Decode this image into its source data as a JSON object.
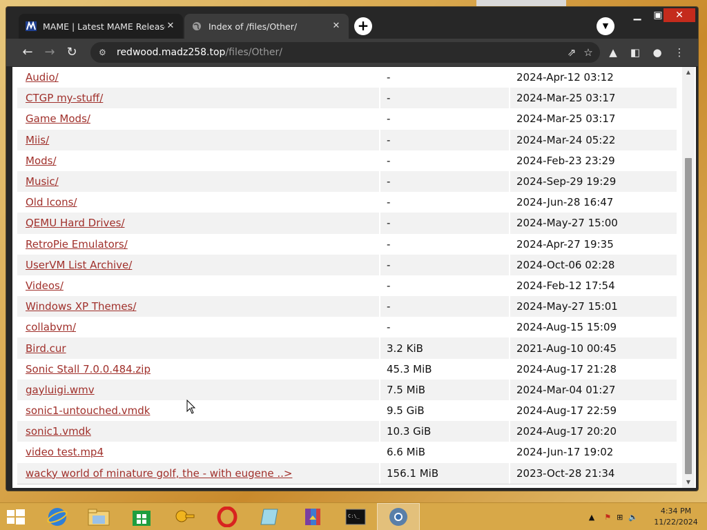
{
  "tabs": [
    {
      "title": "MAME | Latest MAME Release",
      "active": false,
      "favicon": "mame-logo-icon"
    },
    {
      "title": "Index of /files/Other/",
      "active": true,
      "favicon": "globe-icon"
    }
  ],
  "address": {
    "host": "redwood.madz258.top",
    "path": "/files/Other/"
  },
  "listing": [
    {
      "name": "Audio/",
      "size": "-",
      "date": "2024-Apr-12 03:12"
    },
    {
      "name": "CTGP my-stuff/",
      "size": "-",
      "date": "2024-Mar-25 03:17"
    },
    {
      "name": "Game Mods/",
      "size": "-",
      "date": "2024-Mar-25 03:17"
    },
    {
      "name": "Miis/",
      "size": "-",
      "date": "2024-Mar-24 05:22"
    },
    {
      "name": "Mods/",
      "size": "-",
      "date": "2024-Feb-23 23:29"
    },
    {
      "name": "Music/",
      "size": "-",
      "date": "2024-Sep-29 19:29"
    },
    {
      "name": "Old Icons/",
      "size": "-",
      "date": "2024-Jun-28 16:47"
    },
    {
      "name": "QEMU Hard Drives/",
      "size": "-",
      "date": "2024-May-27 15:00"
    },
    {
      "name": "RetroPie Emulators/",
      "size": "-",
      "date": "2024-Apr-27 19:35"
    },
    {
      "name": "UserVM List Archive/",
      "size": "-",
      "date": "2024-Oct-06 02:28"
    },
    {
      "name": "Videos/",
      "size": "-",
      "date": "2024-Feb-12 17:54"
    },
    {
      "name": "Windows XP Themes/",
      "size": "-",
      "date": "2024-May-27 15:01"
    },
    {
      "name": "collabvm/",
      "size": "-",
      "date": "2024-Aug-15 15:09"
    },
    {
      "name": "Bird.cur",
      "size": "3.2 KiB",
      "date": "2021-Aug-10 00:45"
    },
    {
      "name": "Sonic Stall 7.0.0.484.zip",
      "size": "45.3 MiB",
      "date": "2024-Aug-17 21:28"
    },
    {
      "name": "gayluigi.wmv",
      "size": "7.5 MiB",
      "date": "2024-Mar-04 01:27"
    },
    {
      "name": "sonic1-untouched.vmdk",
      "size": "9.5 GiB",
      "date": "2024-Aug-17 22:59"
    },
    {
      "name": "sonic1.vmdk",
      "size": "10.3 GiB",
      "date": "2024-Aug-17 20:20"
    },
    {
      "name": "video test.mp4",
      "size": "6.6 MiB",
      "date": "2024-Jun-17 19:02"
    },
    {
      "name": "wacky world of minature golf, the - with eugene ..>",
      "size": "156.1 MiB",
      "date": "2023-Oct-28 21:34"
    }
  ],
  "clock": {
    "time": "4:34 PM",
    "date": "11/22/2024"
  },
  "colors": {
    "link": "#a0302b",
    "taskbar": "#d8a848",
    "close": "#c42b1c"
  }
}
